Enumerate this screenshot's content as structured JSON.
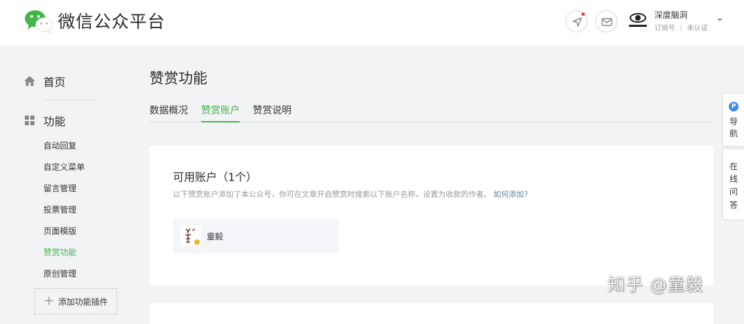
{
  "header": {
    "brand": "微信公众平台",
    "account": {
      "name": "深度脑洞",
      "type": "订阅号",
      "verify_status": "未认证"
    },
    "icons": {
      "logo": "wechat-logo",
      "notify": "location-arrow-icon",
      "mail": "mail-icon"
    }
  },
  "sidebar": {
    "home": "首页",
    "features": "功能",
    "sub_items": [
      "自动回复",
      "自定义菜单",
      "留言管理",
      "投票管理",
      "页面模版",
      "赞赏功能",
      "原创管理"
    ],
    "active_item": "赞赏功能",
    "add_plugin": "添加功能插件"
  },
  "main": {
    "title": "赞赏功能",
    "tabs": [
      "数据概况",
      "赞赏账户",
      "赞赏说明"
    ],
    "active_tab": "赞赏账户",
    "card": {
      "title": "可用账户（1个）",
      "desc": "以下赞赏账户添加了本公众号，你可在文章开启赞赏时搜索以下账户名称，设置为收款的作者。",
      "link": "如何添加?",
      "account_name": "童毅"
    }
  },
  "float": {
    "nav_badge": "P",
    "nav_chars": [
      "导",
      "航"
    ],
    "help_chars": [
      "在",
      "线",
      "问",
      "答"
    ]
  },
  "watermark": "知乎 @童毅",
  "colors": {
    "accent": "#44b549",
    "link": "#607fa6",
    "background": "#f2f3f5"
  }
}
